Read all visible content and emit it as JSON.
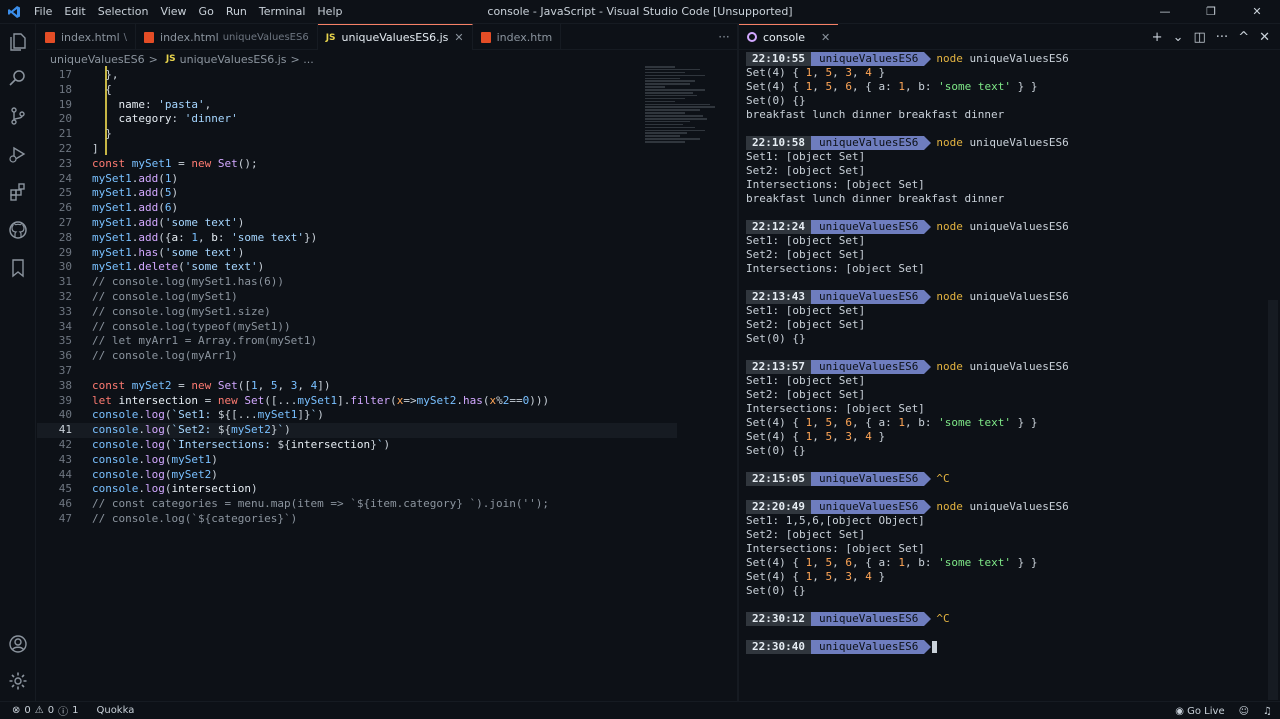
{
  "window": {
    "title": "console - JavaScript - Visual Studio Code [Unsupported]",
    "menu": [
      "File",
      "Edit",
      "Selection",
      "View",
      "Go",
      "Run",
      "Terminal",
      "Help"
    ]
  },
  "editor": {
    "tabs": [
      {
        "label": "index.html",
        "sub": "\\",
        "type": "html"
      },
      {
        "label": "index.html",
        "sub": "uniqueValuesES6",
        "type": "html"
      },
      {
        "label": "uniqueValuesES6.js",
        "sub": "",
        "type": "js",
        "active": true
      },
      {
        "label": "index.htm",
        "sub": "",
        "type": "html"
      }
    ],
    "more": "···",
    "breadcrumb": {
      "folder": "uniqueValuesES6",
      "sep": ">",
      "file": "uniqueValuesES6.js",
      "tail": "> ..."
    },
    "lines": [
      {
        "n": "17",
        "html": "  <span class='tok-pl'>},</span>"
      },
      {
        "n": "18",
        "html": "  <span class='tok-pl'>{</span>"
      },
      {
        "n": "19",
        "html": "    <span class='hl'>name</span><span class='tok-pl'>: </span><span class='tok-str'>'pasta'</span><span class='tok-pl'>,</span>"
      },
      {
        "n": "20",
        "html": "    <span class='hl'>category</span><span class='tok-pl'>: </span><span class='tok-str'>'dinner'</span>"
      },
      {
        "n": "21",
        "html": "  <span class='tok-pl'>}</span>"
      },
      {
        "n": "22",
        "html": "<span class='tok-pl'>]</span>"
      },
      {
        "n": "23",
        "html": "<span class='tok-kw'>const</span> <span class='tok-num'>mySet1</span> = <span class='tok-kw'>new</span> <span class='tok-fn'>Set</span>();"
      },
      {
        "n": "24",
        "html": "<span class='tok-num'>mySet1</span>.<span class='tok-fn'>add</span>(<span class='tok-num'>1</span>)"
      },
      {
        "n": "25",
        "html": "<span class='tok-num'>mySet1</span>.<span class='tok-fn'>add</span>(<span class='tok-num'>5</span>)"
      },
      {
        "n": "26",
        "html": "<span class='tok-num'>mySet1</span>.<span class='tok-fn'>add</span>(<span class='tok-num'>6</span>)"
      },
      {
        "n": "27",
        "html": "<span class='tok-num'>mySet1</span>.<span class='tok-fn'>add</span>(<span class='tok-str'>'some text'</span>)"
      },
      {
        "n": "28",
        "html": "<span class='tok-num'>mySet1</span>.<span class='tok-fn'>add</span>({<span class='hl'>a</span>: <span class='tok-num'>1</span>, <span class='hl'>b</span>: <span class='tok-str'>'some text'</span>})"
      },
      {
        "n": "29",
        "html": "<span class='tok-num'>mySet1</span>.<span class='tok-fn'>has</span>(<span class='tok-str'>'some text'</span>)"
      },
      {
        "n": "30",
        "html": "<span class='tok-num'>mySet1</span>.<span class='tok-fn'>delete</span>(<span class='tok-str'>'some text'</span>)"
      },
      {
        "n": "31",
        "html": "<span class='tok-cm'>// console.log(mySet1.has(6))</span>"
      },
      {
        "n": "32",
        "html": "<span class='tok-cm'>// console.log(mySet1)</span>"
      },
      {
        "n": "33",
        "html": "<span class='tok-cm'>// console.log(mySet1.size)</span>"
      },
      {
        "n": "34",
        "html": "<span class='tok-cm'>// console.log(typeof(mySet1))</span>"
      },
      {
        "n": "35",
        "html": "<span class='tok-cm'>// let myArr1 = Array.from(mySet1)</span>"
      },
      {
        "n": "36",
        "html": "<span class='tok-cm'>// console.log(myArr1)</span>"
      },
      {
        "n": "37",
        "html": ""
      },
      {
        "n": "38",
        "html": "<span class='tok-kw'>const</span> <span class='tok-num'>mySet2</span> = <span class='tok-kw'>new</span> <span class='tok-fn'>Set</span>([<span class='tok-num'>1</span>, <span class='tok-num'>5</span>, <span class='tok-num'>3</span>, <span class='tok-num'>4</span>])"
      },
      {
        "n": "39",
        "html": "<span class='tok-kw'>let</span> <span class='hl'>intersection</span> = <span class='tok-kw'>new</span> <span class='tok-fn'>Set</span>([...<span class='tok-num'>mySet1</span>].<span class='tok-fn'>filter</span>(<span class='tok-var'>x</span>=&gt;<span class='tok-num'>mySet2</span>.<span class='tok-fn'>has</span>(<span class='tok-var'>x</span>%<span class='tok-num'>2</span>==<span class='tok-num'>0</span>)))"
      },
      {
        "n": "40",
        "html": "<span class='tok-num'>console</span>.<span class='tok-fn'>log</span>(<span class='tok-str'>`Set1: </span>${[...<span class='tok-num'>mySet1</span>]}<span class='tok-str'>`</span>)"
      },
      {
        "n": "41",
        "html": "<span class='tok-num'>console</span>.<span class='tok-fn'>log</span>(<span class='tok-str'>`Set2: </span>${<span class='tok-num'>mySet2</span>}<span class='tok-str'>`</span>)",
        "current": true
      },
      {
        "n": "42",
        "html": "<span class='tok-num'>console</span>.<span class='tok-fn'>log</span>(<span class='tok-str'>`Intersections: </span>${<span class='hl'>intersection</span>}<span class='tok-str'>`</span>)"
      },
      {
        "n": "43",
        "html": "<span class='tok-num'>console</span>.<span class='tok-fn'>log</span>(<span class='tok-num'>mySet1</span>)"
      },
      {
        "n": "44",
        "html": "<span class='tok-num'>console</span>.<span class='tok-fn'>log</span>(<span class='tok-num'>mySet2</span>)"
      },
      {
        "n": "45",
        "html": "<span class='tok-num'>console</span>.<span class='tok-fn'>log</span>(<span class='hl'>intersection</span>)"
      },
      {
        "n": "46",
        "html": "<span class='tok-cm'>// const categories = menu.map(item =&gt; `${item.category} `).join('');</span>"
      },
      {
        "n": "47",
        "html": "<span class='tok-cm'>// console.log(`${categories}`)</span>"
      }
    ]
  },
  "terminal": {
    "tab_label": "console",
    "actions": [
      "+",
      "⌄",
      "◫",
      "···",
      "^",
      "✕"
    ],
    "blocks": [
      {
        "time": "22:10:55",
        "dir": "uniqueValuesES6",
        "cmd": "node",
        "arg": "uniqueValuesES6",
        "out": [
          "Set(4) { <span class='t-num'>1</span>, <span class='t-num'>5</span>, <span class='t-num'>3</span>, <span class='t-num'>4</span> }",
          "Set(4) { <span class='t-num'>1</span>, <span class='t-num'>5</span>, <span class='t-num'>6</span>, { a: <span class='t-num'>1</span>, b: <span class='t-str'>'some text'</span> } }",
          "Set(0) {}",
          "breakfast lunch dinner breakfast dinner"
        ]
      },
      {
        "time": "22:10:58",
        "dir": "uniqueValuesES6",
        "cmd": "node",
        "arg": "uniqueValuesES6",
        "out": [
          "Set1: [object Set]",
          "Set2: [object Set]",
          "Intersections: [object Set]",
          "breakfast lunch dinner breakfast dinner"
        ]
      },
      {
        "time": "22:12:24",
        "dir": "uniqueValuesES6",
        "cmd": "node",
        "arg": "uniqueValuesES6",
        "out": [
          "Set1: [object Set]",
          "Set2: [object Set]",
          "Intersections: [object Set]"
        ]
      },
      {
        "time": "22:13:43",
        "dir": "uniqueValuesES6",
        "cmd": "node",
        "arg": "uniqueValuesES6",
        "out": [
          "Set1: [object Set]",
          "Set2: [object Set]",
          "Set(0) {}"
        ]
      },
      {
        "time": "22:13:57",
        "dir": "uniqueValuesES6",
        "cmd": "node",
        "arg": "uniqueValuesES6",
        "out": [
          "Set1: [object Set]",
          "Set2: [object Set]",
          "Intersections: [object Set]",
          "Set(4) { <span class='t-num'>1</span>, <span class='t-num'>5</span>, <span class='t-num'>6</span>, { a: <span class='t-num'>1</span>, b: <span class='t-str'>'some text'</span> } }",
          "Set(4) { <span class='t-num'>1</span>, <span class='t-num'>5</span>, <span class='t-num'>3</span>, <span class='t-num'>4</span> }",
          "Set(0) {}"
        ]
      },
      {
        "time": "22:15:05",
        "dir": "uniqueValuesES6",
        "cmd": "^C",
        "arg": "",
        "out": []
      },
      {
        "time": "22:20:49",
        "dir": "uniqueValuesES6",
        "cmd": "node",
        "arg": "uniqueValuesES6",
        "out": [
          "Set1: 1,5,6,[object Object]",
          "Set2: [object Set]",
          "Intersections: [object Set]",
          "Set(4) { <span class='t-num'>1</span>, <span class='t-num'>5</span>, <span class='t-num'>6</span>, { a: <span class='t-num'>1</span>, b: <span class='t-str'>'some text'</span> } }",
          "Set(4) { <span class='t-num'>1</span>, <span class='t-num'>5</span>, <span class='t-num'>3</span>, <span class='t-num'>4</span> }",
          "Set(0) {}"
        ]
      },
      {
        "time": "22:30:12",
        "dir": "uniqueValuesES6",
        "cmd": "^C",
        "arg": "",
        "out": []
      },
      {
        "time": "22:30:40",
        "dir": "uniqueValuesES6",
        "cmd": "",
        "arg": "",
        "out": [],
        "prompt": true
      }
    ]
  },
  "status": {
    "errors": "0",
    "warnings": "0",
    "info": "1",
    "quokka": "Quokka",
    "golive": "Go Live"
  },
  "colors": {
    "accent": "#f78166",
    "prompt_dir": "#6e7dbe",
    "html_icon": "#e44d26",
    "js_icon": "#e8d44d"
  }
}
